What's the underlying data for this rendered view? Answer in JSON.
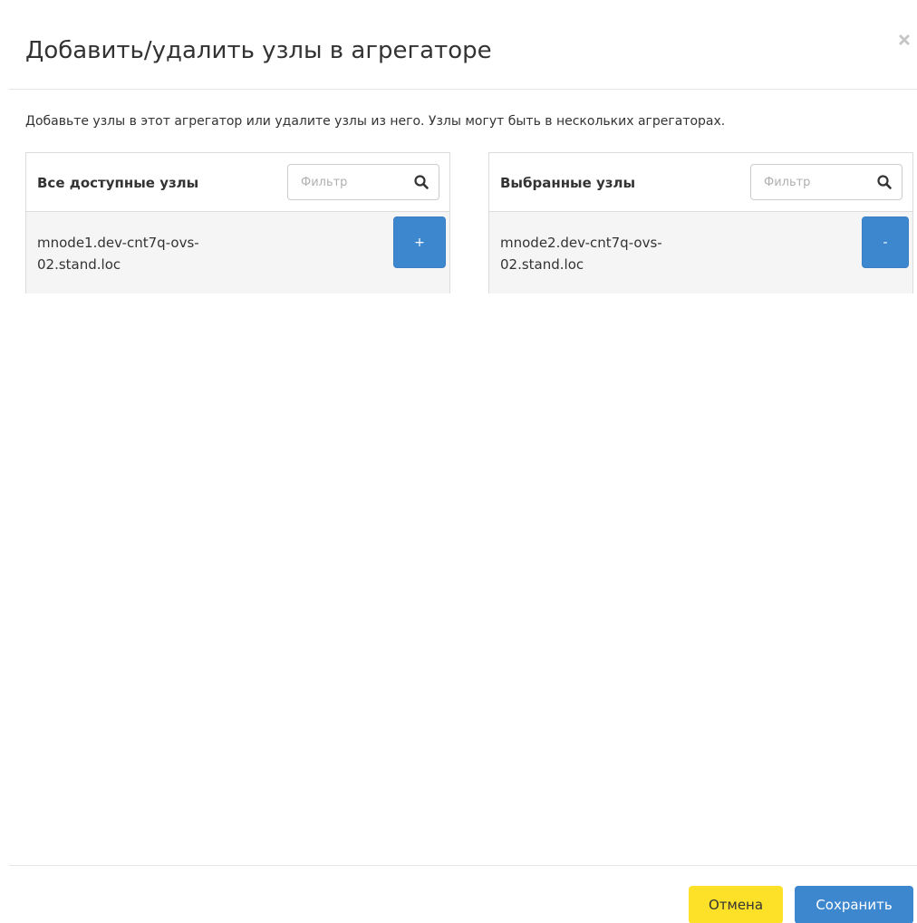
{
  "dialog": {
    "title": "Добавить/удалить узлы в агрегаторе",
    "description": "Добавьте узлы в этот агрегатор или удалите узлы из него. Узлы могут быть в нескольких агрегаторах."
  },
  "available": {
    "title": "Все доступные узлы",
    "filter_placeholder": "Фильтр",
    "items": [
      {
        "name": "mnode1.dev-cnt7q-ovs-02.stand.loc",
        "action_label": "+"
      }
    ]
  },
  "selected": {
    "title": "Выбранные узлы",
    "filter_placeholder": "Фильтр",
    "items": [
      {
        "name": "mnode2.dev-cnt7q-ovs-02.stand.loc",
        "action_label": "-"
      }
    ]
  },
  "footer": {
    "cancel_label": "Отмена",
    "save_label": "Сохранить"
  },
  "icons": {
    "close": "close-icon",
    "search": "search-icon"
  },
  "colors": {
    "primary": "#3d87cf",
    "cancel": "#fde128",
    "row_background": "#f5f5f5"
  }
}
